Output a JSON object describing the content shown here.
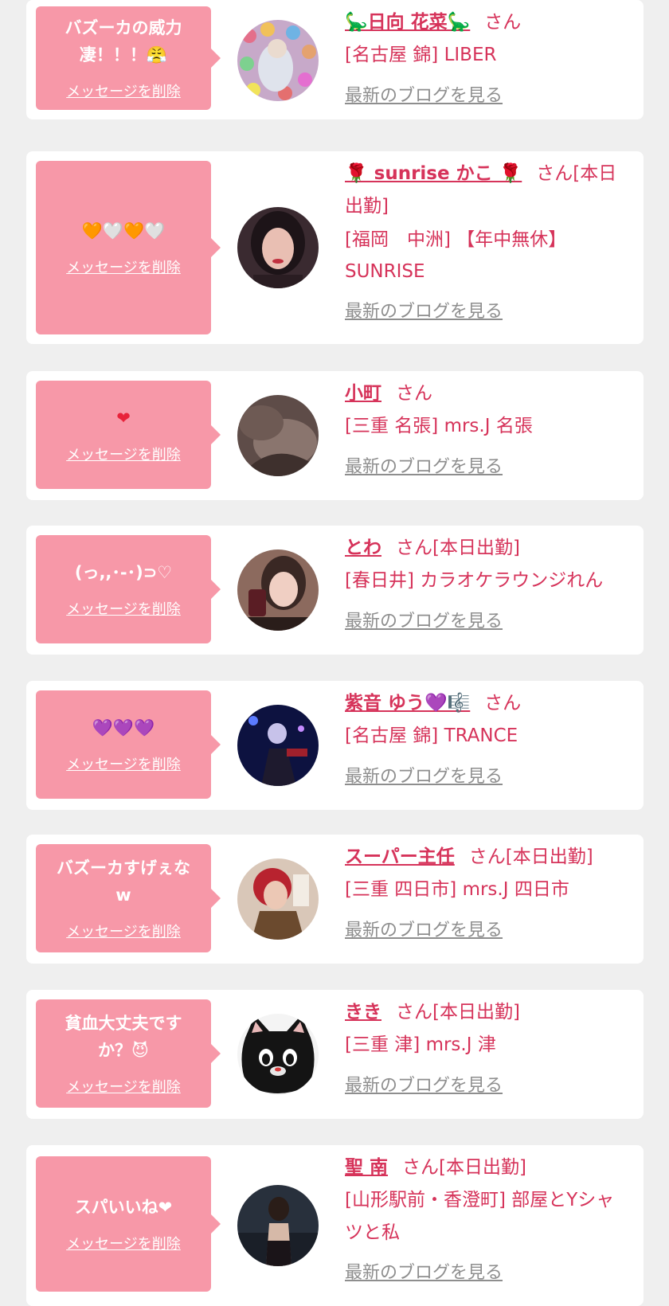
{
  "theme": {
    "accent": "#d6335a",
    "bubble": "#f798a8",
    "link_gray": "#8e8e8e",
    "background": "#efefef"
  },
  "items": [
    {
      "message": "バズーカの威力\n凄！！！😤",
      "delete_label": "メッセージを削除",
      "name": "🦕日向 花菜🦕",
      "suffix": "さん",
      "shop": "[名古屋 錦] LIBER",
      "blog_label": "最新のブログを見る",
      "avatar_icon": "colorful-balls-photo"
    },
    {
      "message": "🧡🤍🧡🤍",
      "delete_label": "メッセージを削除",
      "name": "🌹 sunrise かこ 🌹",
      "suffix": "さん[本日出勤]",
      "shop": "[福岡　中洲] 【年中無休】SUNRISE",
      "blog_label": "最新のブログを見る",
      "avatar_icon": "portrait-photo"
    },
    {
      "message": "❤",
      "delete_label": "メッセージを削除",
      "name": "小町",
      "suffix": "さん",
      "shop": "[三重 名張] mrs.J 名張",
      "blog_label": "最新のブログを見る",
      "avatar_icon": "dark-photo"
    },
    {
      "message": "(っ,,･-･)⊃♡",
      "delete_label": "メッセージを削除",
      "name": "とわ",
      "suffix": "さん[本日出勤]",
      "shop": "[春日井] カラオケラウンジれん",
      "blog_label": "最新のブログを見る",
      "avatar_icon": "portrait-with-drink-photo"
    },
    {
      "message": "💜💜💜",
      "delete_label": "メッセージを削除",
      "name": "紫音 ゆう💜🎼",
      "suffix": "さん",
      "shop": "[名古屋 錦] TRANCE",
      "blog_label": "最新のブログを見る",
      "avatar_icon": "night-stage-photo"
    },
    {
      "message": "バズーカすげぇな\nw",
      "delete_label": "メッセージを削除",
      "name": "スーパー主任",
      "suffix": "さん[本日出勤]",
      "shop": "[三重 四日市] mrs.J 四日市",
      "blog_label": "最新のブログを見る",
      "avatar_icon": "red-hair-photo"
    },
    {
      "message": "貧血大丈夫です\nか？😈",
      "delete_label": "メッセージを削除",
      "name": "きき",
      "suffix": "さん[本日出勤]",
      "shop": "[三重 津] mrs.J 津",
      "blog_label": "最新のブログを見る",
      "avatar_icon": "black-cat-character"
    },
    {
      "message": "スパいいね❤",
      "delete_label": "メッセージを削除",
      "name": "聖 南",
      "suffix": "さん[本日出勤]",
      "shop": "[山形駅前・香澄町] 部屋とYシャツと私",
      "blog_label": "最新のブログを見る",
      "avatar_icon": "back-portrait-photo"
    }
  ]
}
